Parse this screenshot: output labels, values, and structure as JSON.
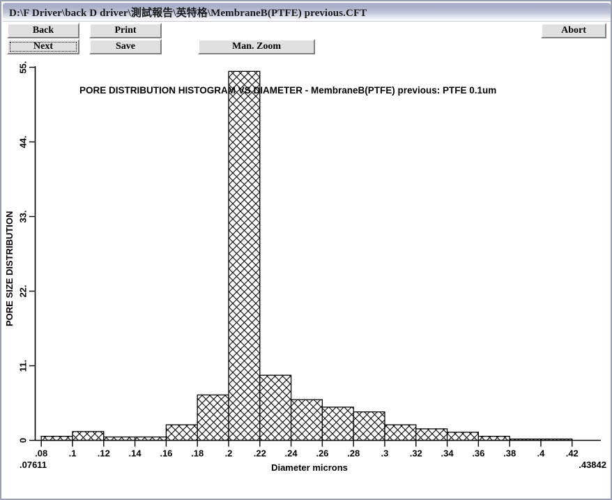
{
  "window": {
    "title": "D:\\F Driver\\back D driver\\測試報告\\英特格\\MembraneB(PTFE) previous.CFT"
  },
  "toolbar": {
    "back_label": "Back",
    "next_label": "Next",
    "print_label": "Print",
    "save_label": "Save",
    "manual_zoom_label": "Man. Zoom",
    "abort_label": "Abort"
  },
  "axis_labels": {
    "x_axis_name": "Diameter microns",
    "y_axis_name": "PORE SIZE DISTRIBUTION",
    "range_min": ".07611",
    "range_max": ".43842"
  },
  "chart_data": {
    "type": "bar",
    "title": "PORE DISTRIBUTION HISTOGRAM VS DIAMETER - MembraneB(PTFE) previous: PTFE 0.1um",
    "xlabel": "Diameter microns",
    "ylabel": "PORE SIZE DISTRIBUTION",
    "xlim": [
      0.07611,
      0.43842
    ],
    "ylim": [
      0,
      55
    ],
    "grid": false,
    "legend": "none",
    "x_ticks": [
      ".08",
      ".1",
      ".12",
      ".14",
      ".16",
      ".18",
      ".2",
      ".22",
      ".24",
      ".26",
      ".28",
      ".3",
      ".32",
      ".34",
      ".36",
      ".38",
      ".4",
      ".42"
    ],
    "x_tick_values": [
      0.08,
      0.1,
      0.12,
      0.14,
      0.16,
      0.18,
      0.2,
      0.22,
      0.24,
      0.26,
      0.28,
      0.3,
      0.32,
      0.34,
      0.36,
      0.38,
      0.4,
      0.42
    ],
    "y_ticks": [
      "0",
      "11.",
      "22.",
      "33.",
      "44.",
      "55."
    ],
    "y_tick_values": [
      0,
      11,
      22,
      33,
      44,
      55
    ],
    "bin_edges": [
      0.08,
      0.1,
      0.12,
      0.14,
      0.16,
      0.18,
      0.2,
      0.22,
      0.24,
      0.26,
      0.28,
      0.3,
      0.32,
      0.34,
      0.36,
      0.38,
      0.4,
      0.42
    ],
    "categories": [
      "0.08-0.10",
      "0.10-0.12",
      "0.12-0.14",
      "0.14-0.16",
      "0.16-0.18",
      "0.18-0.20",
      "0.20-0.22",
      "0.22-0.24",
      "0.24-0.26",
      "0.26-0.28",
      "0.28-0.30",
      "0.30-0.32",
      "0.32-0.34",
      "0.34-0.36",
      "0.36-0.38",
      "0.38-0.40",
      "0.40-0.42"
    ],
    "values": [
      0.6,
      1.3,
      0.5,
      0.5,
      2.3,
      6.7,
      54.4,
      9.6,
      6.0,
      4.9,
      4.2,
      2.3,
      1.7,
      1.2,
      0.6,
      0.2,
      0.2
    ]
  }
}
